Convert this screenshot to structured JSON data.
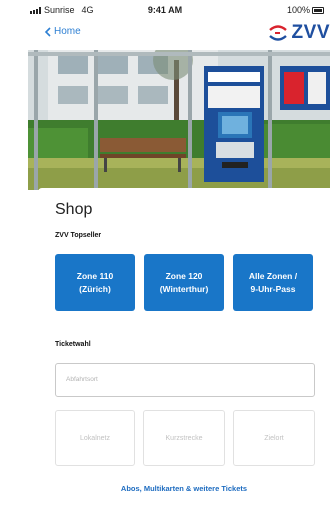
{
  "status_bar": {
    "carrier": "Sunrise",
    "network": "4G",
    "time": "9:41 AM",
    "battery": "100%"
  },
  "nav": {
    "back_label": "Home",
    "logo_text": "ZVV"
  },
  "shop": {
    "title": "Shop",
    "topseller_label": "ZVV Topseller",
    "topseller_buttons": [
      {
        "label": "Zone 110\n(Zürich)"
      },
      {
        "label": "Zone 120\n(Winterthur)"
      },
      {
        "label": "Alle Zonen /\n9-Uhr-Pass"
      }
    ],
    "ticketwahl_label": "Ticketwahl",
    "from_placeholder": "Abfahrtsort",
    "options": [
      {
        "label": "Lokalnetz"
      },
      {
        "label": "Kurzstrecke"
      },
      {
        "label": "Zielort"
      }
    ],
    "more_link": "Abos, Multikarten & weitere Tickets"
  },
  "colors": {
    "accent": "#1976c8",
    "link": "#1e6cc0",
    "logo": "#1f4fa0",
    "logo_mark": "#d9232d"
  }
}
